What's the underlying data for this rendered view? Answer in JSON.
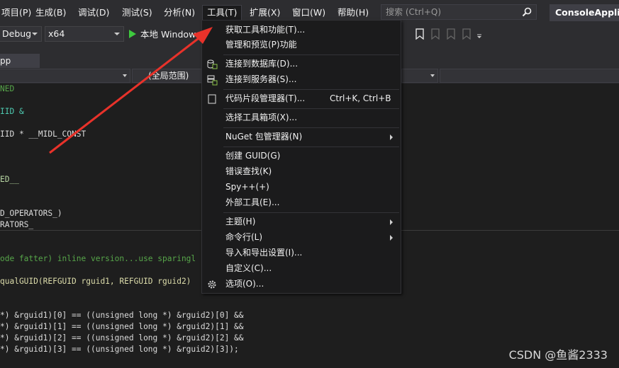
{
  "menubar": {
    "items": [
      "项目(P)",
      "生成(B)",
      "调试(D)",
      "测试(S)",
      "分析(N)",
      "工具(T)",
      "扩展(X)",
      "窗口(W)",
      "帮助(H)"
    ],
    "search_placeholder": "搜索 (Ctrl+Q)",
    "solution_name": "ConsoleApplication"
  },
  "toolbar": {
    "config": "Debug",
    "platform": "x64",
    "run_label": "本地 Windows"
  },
  "tabs": {
    "doc_tab": "pp"
  },
  "navbar": {
    "scope": "(全局范围)"
  },
  "code_lines": [
    "NED",
    "IID &",
    "IID * __MIDL_CONST",
    "ED__",
    "D_OPERATORS_)",
    "RATORS_",
    "ode fatter) inline version...use sparingl",
    "qualGUID(REFGUID rguid1, REFGUID rguid2)",
    "*) &rguid1)[0] == ((unsigned long *) &rguid2)[0] &&",
    "*) &rguid1)[1] == ((unsigned long *) &rguid2)[1] &&",
    "*) &rguid1)[2] == ((unsigned long *) &rguid2)[2] &&",
    "*) &rguid1)[3] == ((unsigned long *) &rguid2)[3]);"
  ],
  "tools_menu": {
    "items": [
      {
        "label": "获取工具和功能(T)...",
        "shortcut": "",
        "submenu": false,
        "icon": ""
      },
      {
        "label": "管理和预览(P)功能",
        "shortcut": "",
        "submenu": false,
        "icon": ""
      },
      {
        "label": "连接到数据库(D)...",
        "shortcut": "",
        "submenu": false,
        "icon": "database-connect-icon"
      },
      {
        "label": "连接到服务器(S)...",
        "shortcut": "",
        "submenu": false,
        "icon": "server-connect-icon"
      },
      {
        "label": "代码片段管理器(T)...",
        "shortcut": "Ctrl+K, Ctrl+B",
        "submenu": false,
        "icon": "snippet-icon"
      },
      {
        "label": "选择工具箱项(X)...",
        "shortcut": "",
        "submenu": false,
        "icon": ""
      },
      {
        "label": "NuGet 包管理器(N)",
        "shortcut": "",
        "submenu": true,
        "icon": ""
      },
      {
        "label": "创建 GUID(G)",
        "shortcut": "",
        "submenu": false,
        "icon": ""
      },
      {
        "label": "错误查找(K)",
        "shortcut": "",
        "submenu": false,
        "icon": ""
      },
      {
        "label": "Spy++(+)",
        "shortcut": "",
        "submenu": false,
        "icon": ""
      },
      {
        "label": "外部工具(E)...",
        "shortcut": "",
        "submenu": false,
        "icon": ""
      },
      {
        "label": "主题(H)",
        "shortcut": "",
        "submenu": true,
        "icon": ""
      },
      {
        "label": "命令行(L)",
        "shortcut": "",
        "submenu": true,
        "icon": ""
      },
      {
        "label": "导入和导出设置(I)...",
        "shortcut": "",
        "submenu": false,
        "icon": ""
      },
      {
        "label": "自定义(C)...",
        "shortcut": "",
        "submenu": false,
        "icon": ""
      },
      {
        "label": "选项(O)...",
        "shortcut": "",
        "submenu": false,
        "icon": "gear-icon"
      }
    ]
  },
  "watermark": "CSDN @鱼酱2333",
  "colors": {
    "background": "#1e1e1e",
    "menubar": "#2d2d30",
    "menu_bg": "#1b1b1c",
    "annotation_arrow": "#e8322a"
  }
}
